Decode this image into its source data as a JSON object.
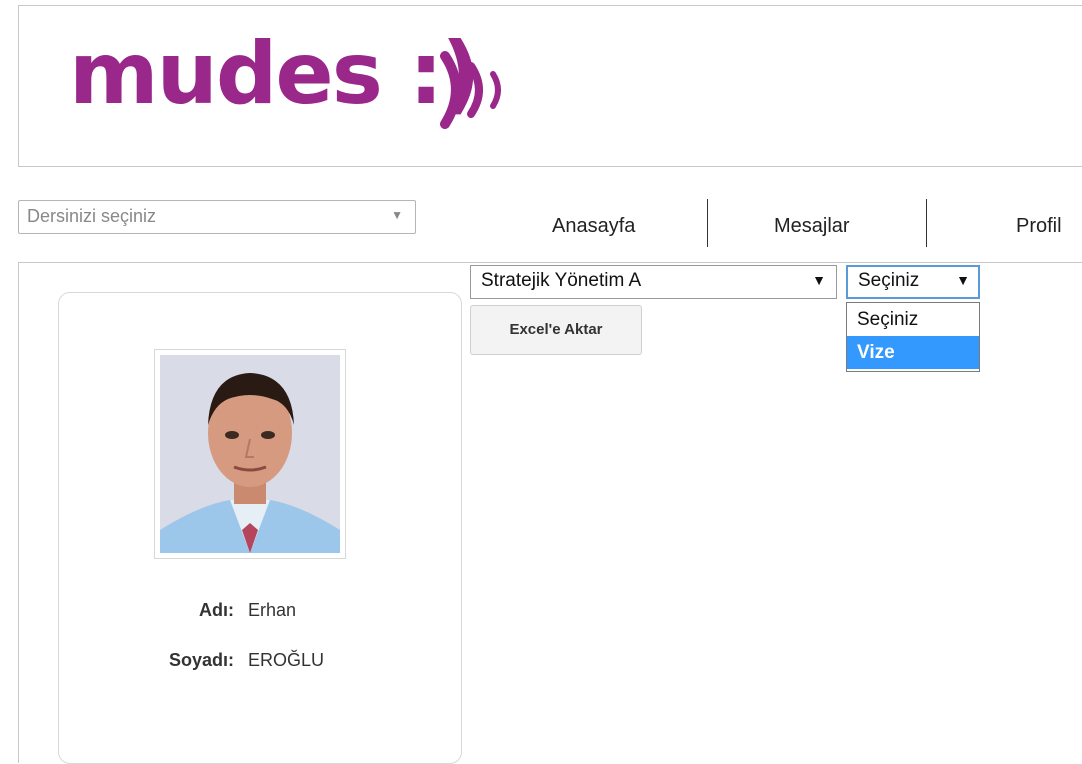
{
  "brand": {
    "logo_text": "mudes :)))",
    "brand_color": "#9a278a"
  },
  "course_picker": {
    "placeholder": "Dersinizi seçiniz",
    "caret": "▼"
  },
  "nav": {
    "items": [
      "Anasayfa",
      "Mesajlar",
      "Profil"
    ]
  },
  "profile": {
    "name_label": "Adı:",
    "name_value": "Erhan",
    "surname_label": "Soyadı:",
    "surname_value": "EROĞLU"
  },
  "filters": {
    "course_selected": "Stratejik Yönetim A",
    "exam_selected": "Seçiniz",
    "exam_options": [
      "Seçiniz",
      "Vize"
    ],
    "highlighted_option": "Vize",
    "caret": "▼",
    "highlight_color": "#3399ff"
  },
  "actions": {
    "export_label": "Excel'e Aktar"
  }
}
